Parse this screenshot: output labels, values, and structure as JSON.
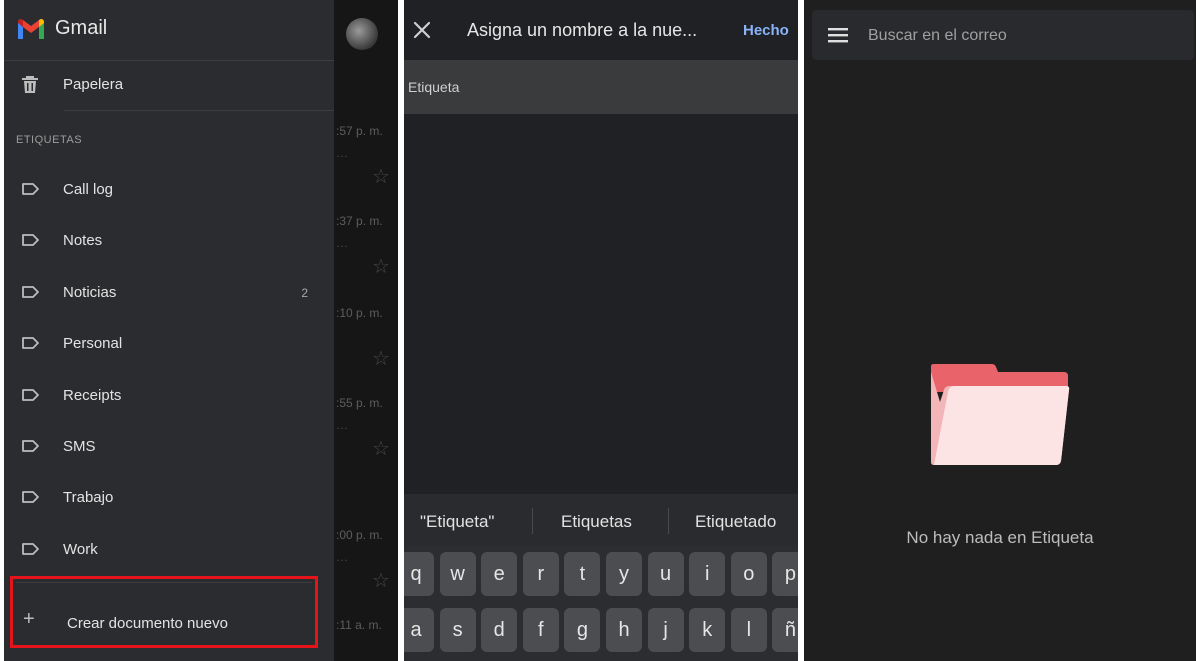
{
  "gmail": {
    "app_title": "Gmail",
    "trash_label": "Papelera",
    "labels_section": "ETIQUETAS",
    "labels": [
      {
        "name": "Call log",
        "count": ""
      },
      {
        "name": "Notes",
        "count": ""
      },
      {
        "name": "Noticias",
        "count": "2"
      },
      {
        "name": "Personal",
        "count": ""
      },
      {
        "name": "Receipts",
        "count": ""
      },
      {
        "name": "SMS",
        "count": ""
      },
      {
        "name": "Trabajo",
        "count": ""
      },
      {
        "name": "Work",
        "count": ""
      }
    ],
    "create_label": "Crear documento nuevo",
    "background_times": [
      ":57 p. m.",
      ":37 p. m.",
      ":10 p. m.",
      ":55 p. m.",
      ":00 p. m.",
      ":11 a. m."
    ]
  },
  "dialog": {
    "title": "Asigna un nombre a la nue...",
    "done": "Hecho",
    "field_placeholder": "Etiqueta"
  },
  "keyboard": {
    "suggestions": [
      "\"Etiqueta\"",
      "Etiquetas",
      "Etiquetado"
    ],
    "row1": [
      "q",
      "w",
      "e",
      "r",
      "t",
      "y",
      "u",
      "i",
      "o",
      "p"
    ],
    "row2": [
      "a",
      "s",
      "d",
      "f",
      "g",
      "h",
      "j",
      "k",
      "l",
      "ñ"
    ]
  },
  "label_view": {
    "search_placeholder": "Buscar en el correo",
    "empty_message": "No hay nada en Etiqueta"
  },
  "colors": {
    "highlight_border": "#e5141b",
    "done_accent": "#8ab4f8",
    "folder_back": "#e8646a",
    "folder_front": "#fce4e4"
  }
}
